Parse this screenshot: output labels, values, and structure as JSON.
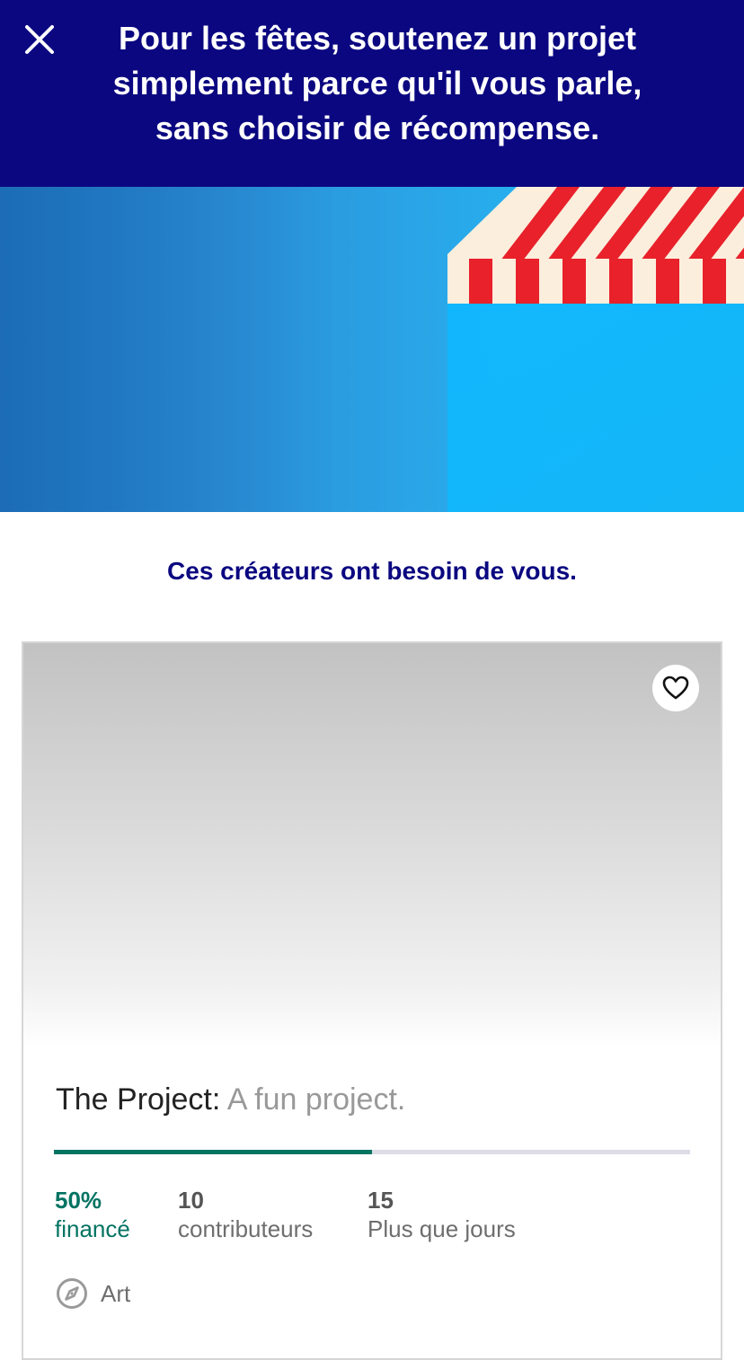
{
  "header": {
    "message": "Pour les fêtes, soutenez un projet simplement parce qu'il vous parle, sans choisir de récompense.",
    "close_icon": "close-icon",
    "background_color": "#0b0780"
  },
  "hero": {
    "awning_colors": [
      "#e8212a",
      "#fbeedd"
    ]
  },
  "section": {
    "subtitle": "Ces créateurs ont besoin de vous."
  },
  "project_card": {
    "favorite_icon": "heart-icon",
    "name": "The Project:",
    "blurb": "A fun project.",
    "funded_fraction": 0.5,
    "stats": {
      "funded_value": "50%",
      "funded_label": "financé",
      "backers_value": "10",
      "backers_label": "contributeurs",
      "days_value": "15",
      "days_label": "Plus que jours"
    },
    "category": {
      "icon": "compass-icon",
      "label": "Art"
    },
    "accent_color": "#037362"
  }
}
